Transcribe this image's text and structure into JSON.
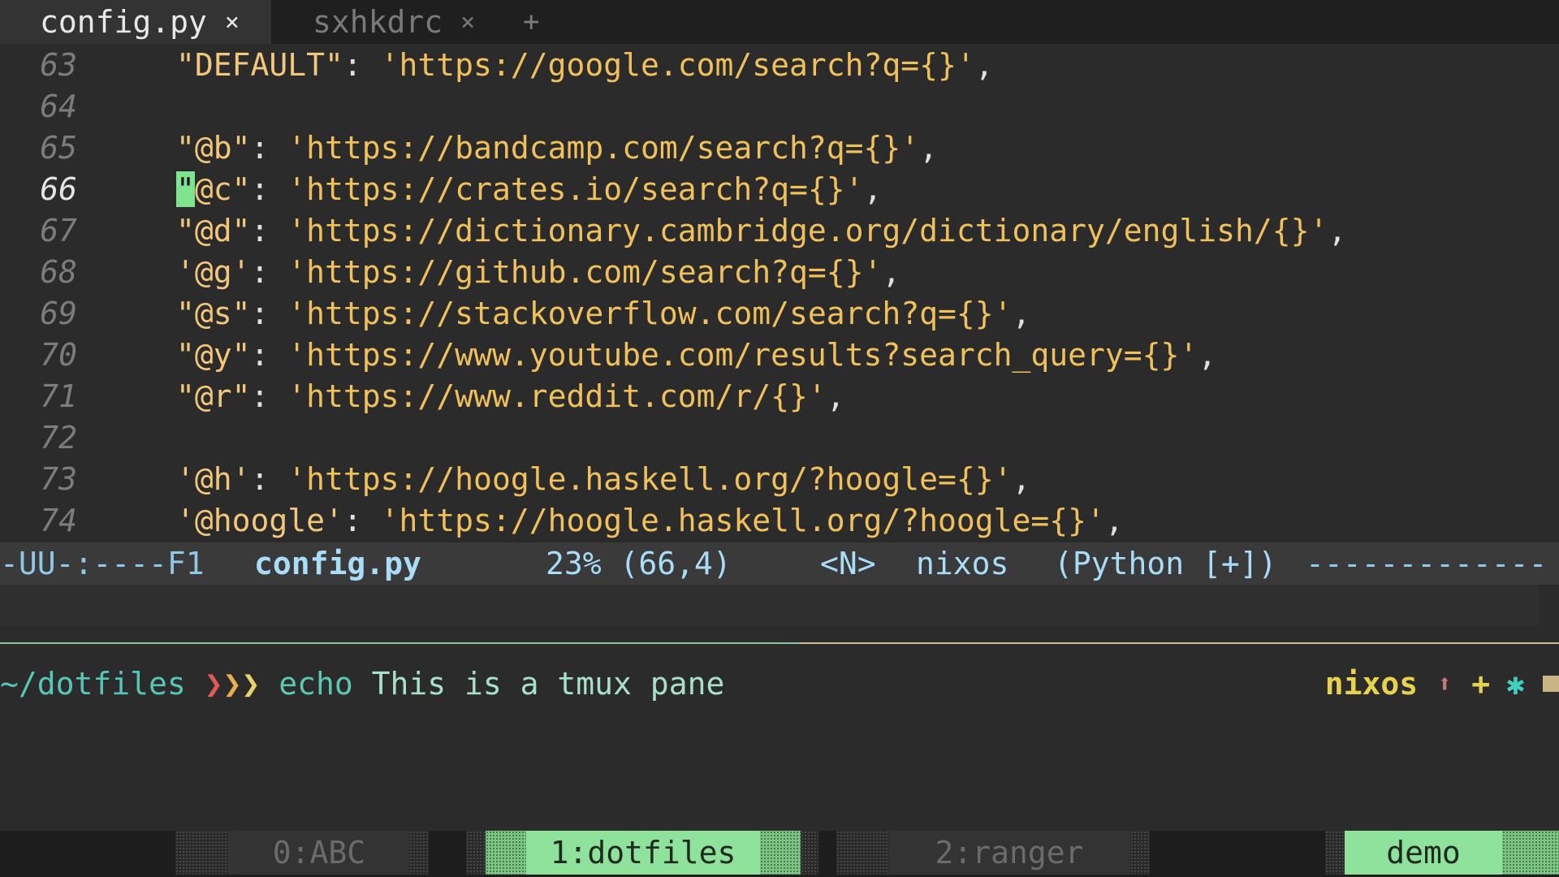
{
  "tabs": [
    {
      "label": "config.py",
      "close": "×",
      "active": true
    },
    {
      "label": "sxhkdrc",
      "close": "×",
      "active": false
    }
  ],
  "tab_add": "+",
  "editor": {
    "lines": [
      {
        "num": "63",
        "key": "\"DEFAULT\"",
        "value": "'https://google.com/search?q={}'"
      },
      {
        "num": "64",
        "key": "",
        "value": ""
      },
      {
        "num": "65",
        "key": "\"@b\"",
        "value": "'https://bandcamp.com/search?q={}'"
      },
      {
        "num": "66",
        "key": "\"@c\"",
        "value": "'https://crates.io/search?q={}'"
      },
      {
        "num": "67",
        "key": "\"@d\"",
        "value": "'https://dictionary.cambridge.org/dictionary/english/{}'"
      },
      {
        "num": "68",
        "key": "'@g'",
        "value": "'https://github.com/search?q={}'"
      },
      {
        "num": "69",
        "key": "\"@s\"",
        "value": "'https://stackoverflow.com/search?q={}'"
      },
      {
        "num": "70",
        "key": "\"@y\"",
        "value": "'https://www.youtube.com/results?search_query={}'"
      },
      {
        "num": "71",
        "key": "\"@r\"",
        "value": "'https://www.reddit.com/r/{}'"
      },
      {
        "num": "72",
        "key": "",
        "value": ""
      },
      {
        "num": "73",
        "key": "'@h'",
        "value": "'https://hoogle.haskell.org/?hoogle={}'"
      },
      {
        "num": "74",
        "key": "'@hoogle'",
        "value": "'https://hoogle.haskell.org/?hoogle={}'"
      }
    ],
    "current_line": "66"
  },
  "modeline": {
    "status": "-UU-:----F1",
    "file": "config.py",
    "position": "23% (66,4)",
    "state": "<N>",
    "host": "nixos",
    "mode": "(Python [+])",
    "dashes": "-------------"
  },
  "shell": {
    "cwd": "~/dotfiles",
    "arrows": [
      "❯",
      "❯",
      "❯"
    ],
    "command": "echo",
    "args": "This is a tmux pane",
    "right_prompt": {
      "host": "nixos",
      "up": "⬆",
      "plus": "+",
      "star": "✱"
    }
  },
  "tmux": {
    "windows": [
      {
        "label": "0:ABC",
        "active": false
      },
      {
        "label": "1:dotfiles",
        "active": true
      },
      {
        "label": "2:ranger",
        "active": false
      }
    ],
    "session": "demo"
  },
  "colors": {
    "background": "#2b2b2b",
    "string": "#f0c05b",
    "cursor": "#7ee58e",
    "modeline_text": "#a9dcf7",
    "tmux_active": "#8fe29c",
    "prompt_cyan": "#55c7b6",
    "host_yellow": "#e7d24c"
  }
}
